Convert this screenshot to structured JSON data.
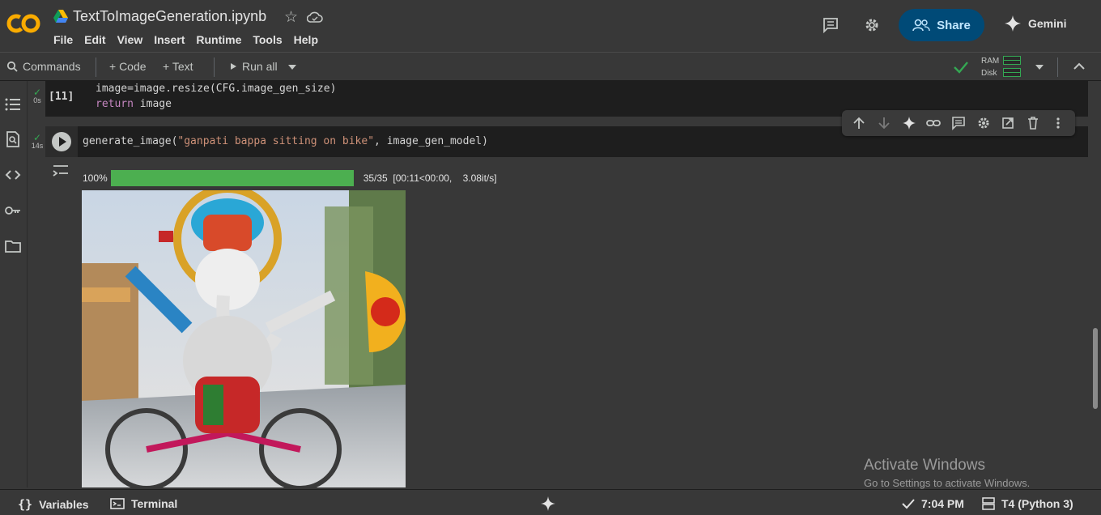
{
  "header": {
    "title": "TextToImageGeneration.ipynb",
    "menu": [
      "File",
      "Edit",
      "View",
      "Insert",
      "Runtime",
      "Tools",
      "Help"
    ],
    "share_label": "Share",
    "gemini_label": "Gemini"
  },
  "toolbar": {
    "commands_label": "Commands",
    "code_label": "+ Code",
    "text_label": "+ Text",
    "run_all_label": "Run all",
    "ram_label": "RAM",
    "disk_label": "Disk"
  },
  "cells": {
    "cell1": {
      "exec_label": "[11]",
      "status_time": "0s",
      "line1": "image=image.resize(CFG.image_gen_size)",
      "line2_kw": "return",
      "line2_rest": " image"
    },
    "cell2": {
      "status_time": "14s",
      "fn": "generate_image(",
      "str_arg": "\"ganpati bappa sitting on bike\"",
      "rest": ", image_gen_model)"
    }
  },
  "output": {
    "percent_label": "100%",
    "progress": 1.0,
    "progress_stats": "35/35  [00:11<00:00,    3.08it/s]"
  },
  "watermark": {
    "line1": "Activate Windows",
    "line2": "Go to Settings to activate Windows."
  },
  "statusbar": {
    "variables_label": "Variables",
    "terminal_label": "Terminal",
    "time_label": "7:04 PM",
    "runtime_label": "T4 (Python 3)"
  },
  "colors": {
    "brand_orange": "#f9ab00",
    "accent_green": "#34a853",
    "share_bg": "#004a77",
    "string": "#ce9178",
    "keyword": "#c586c0"
  }
}
